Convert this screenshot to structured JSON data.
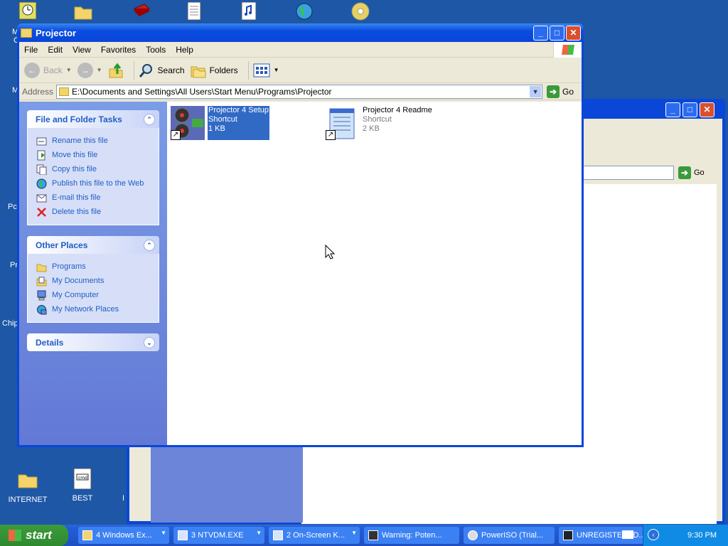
{
  "desktop": {
    "top_icons": [
      "clock-icon",
      "folder-icon",
      "book-icon",
      "document-icon",
      "audio-file-icon",
      "globe-icon",
      "disc-icon"
    ],
    "icons": [
      {
        "label": "INTERNET",
        "icon": "folder-icon"
      },
      {
        "label": "BEST",
        "icon": "document-icon"
      }
    ],
    "fragments": [
      "M",
      "C",
      "M",
      "Pc",
      "Pr",
      "Chip",
      "I"
    ]
  },
  "window": {
    "title": "Projector",
    "menu": [
      "File",
      "Edit",
      "View",
      "Favorites",
      "Tools",
      "Help"
    ],
    "toolbar": {
      "back": "Back",
      "search": "Search",
      "folders": "Folders"
    },
    "address": {
      "label": "Address",
      "value": "E:\\Documents and Settings\\All Users\\Start Menu\\Programs\\Projector",
      "go": "Go"
    },
    "tasks_panel": {
      "title": "File and Folder Tasks",
      "items": [
        {
          "label": "Rename this file",
          "icon": "rename-icon"
        },
        {
          "label": "Move this file",
          "icon": "move-icon"
        },
        {
          "label": "Copy this file",
          "icon": "copy-icon"
        },
        {
          "label": "Publish this file to the Web",
          "icon": "globe-icon"
        },
        {
          "label": "E-mail this file",
          "icon": "email-icon"
        },
        {
          "label": "Delete this file",
          "icon": "delete-icon"
        }
      ]
    },
    "places_panel": {
      "title": "Other Places",
      "items": [
        {
          "label": "Programs",
          "icon": "folder-icon"
        },
        {
          "label": "My Documents",
          "icon": "documents-icon"
        },
        {
          "label": "My Computer",
          "icon": "computer-icon"
        },
        {
          "label": "My Network Places",
          "icon": "network-icon"
        }
      ]
    },
    "details_panel": {
      "title": "Details"
    },
    "files": [
      {
        "name": "Projector 4 Setup",
        "type": "Shortcut",
        "size": "1 KB",
        "selected": true
      },
      {
        "name": "Projector 4 Readme",
        "type": "Shortcut",
        "size": "2 KB",
        "selected": false
      }
    ]
  },
  "background_window": {
    "go": "Go"
  },
  "taskbar": {
    "start": "start",
    "tasks": [
      {
        "label": "4 Windows Ex...",
        "has_dropdown": true
      },
      {
        "label": "3 NTVDM.EXE",
        "has_dropdown": true
      },
      {
        "label": "2 On-Screen K...",
        "has_dropdown": true
      },
      {
        "label": "Warning: Poten...",
        "has_dropdown": false
      },
      {
        "label": "PowerISO (Trial...",
        "has_dropdown": false
      },
      {
        "label": "UNREGISTERED...",
        "has_dropdown": false
      }
    ],
    "clock": "9:30 PM"
  },
  "colors": {
    "desktop": "#1d57a6",
    "title_blue": "#0a46d8",
    "task_pane": "#6279d6",
    "link": "#215dc6",
    "selection": "#316ac5",
    "start_green": "#3c9a3c"
  }
}
